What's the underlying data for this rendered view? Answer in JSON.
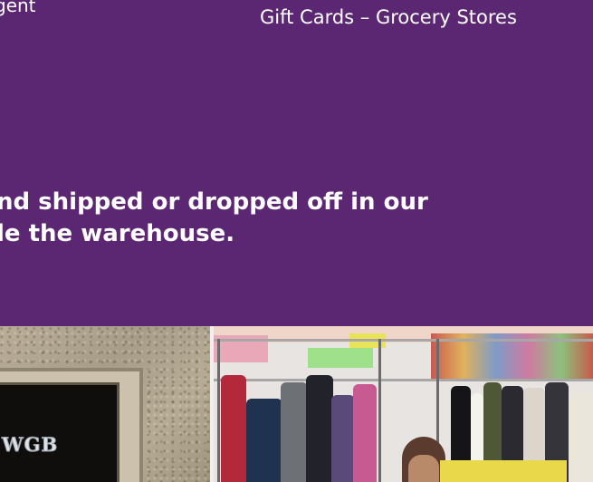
{
  "top": {
    "left_fragment": "gent",
    "right_text": "Gift Cards – Grocery Stores"
  },
  "headline": {
    "line1": "nd shipped or dropped off in our",
    "line2": "le the warehouse."
  },
  "photos": {
    "left_sign_text": "WGB"
  },
  "colors": {
    "background": "#5c2772",
    "text": "#ffffff"
  }
}
